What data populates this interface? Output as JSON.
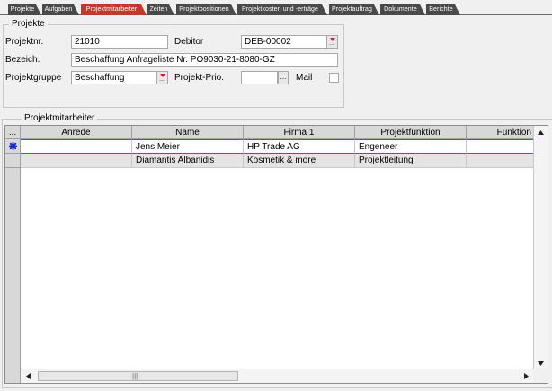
{
  "tabs": [
    {
      "label": "Projekte",
      "active": false
    },
    {
      "label": "Aufgaben",
      "active": false
    },
    {
      "label": "Projektmitarbeiter",
      "active": true
    },
    {
      "label": "Zeiten",
      "active": false
    },
    {
      "label": "Projektpositionen",
      "active": false
    },
    {
      "label": "Projektkosten und -erträge",
      "active": false
    },
    {
      "label": "Projektauftrag",
      "active": false
    },
    {
      "label": "Dokumente",
      "active": false
    },
    {
      "label": "Berichte",
      "active": false
    }
  ],
  "projekte": {
    "title": "Projekte",
    "projektnr_label": "Projektnr.",
    "projektnr_value": "21010",
    "debitor_label": "Debitor",
    "debitor_value": "DEB-00002",
    "bezeich_label": "Bezeich.",
    "bezeich_value": "Beschaffung Anfrageliste Nr. PO9030-21-8080-GZ",
    "projektgruppe_label": "Projektgruppe",
    "projektgruppe_value": "Beschaffung",
    "prio_label": "Projekt-Prio.",
    "prio_value": "",
    "mail_label": "Mail",
    "mail_checked": false,
    "ellipsis": "..."
  },
  "mitarbeiter": {
    "title": "Projektmitarbeiter",
    "selector_header": "...",
    "columns": [
      "Anrede",
      "Name",
      "Firma 1",
      "Projektfunktion",
      "Funktion"
    ],
    "rows": [
      [
        "",
        "Jens Meier",
        "HP Trade AG",
        "Engeneer",
        ""
      ],
      [
        "",
        "Diamantis Albanidis",
        "Kosmetik & more",
        "Projektleitung",
        ""
      ]
    ],
    "hscroll_grip": "|||"
  },
  "icons": {
    "current_row": "asterisk-icon",
    "dropdown": "dropdown-arrow-icon",
    "scroll_up": "arrow-up-icon",
    "scroll_down": "arrow-down-icon",
    "scroll_left": "arrow-left-icon",
    "scroll_right": "arrow-right-icon"
  },
  "colors": {
    "active_tab": "#c0392b",
    "inactive_tab": "#4a4a4a",
    "selection_line": "#4060c0",
    "current_row_marker": "#1a2fd0",
    "dropdown_arrow": "#d0202a"
  }
}
